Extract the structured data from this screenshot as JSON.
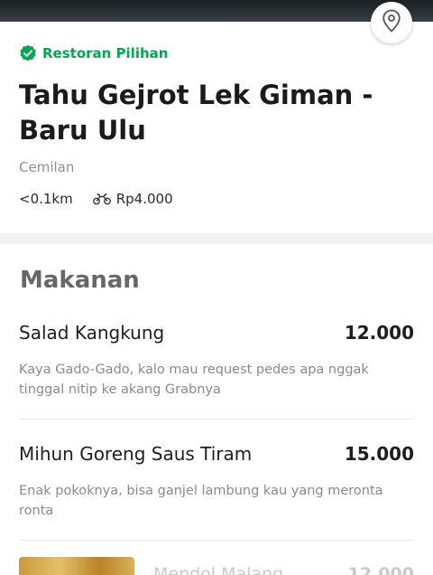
{
  "header": {
    "badge_label": "Restoran Pilihan",
    "icons": {
      "badge": "verified-check-icon",
      "map": "map-pin-icon",
      "delivery": "motorbike-icon"
    },
    "accent_color": "#00a651"
  },
  "restaurant": {
    "name": "Tahu Gejrot Lek Giman - Baru Ulu",
    "category": "Cemilan",
    "distance": "<0.1km",
    "delivery_fee": "Rp4.000"
  },
  "menu": {
    "section_title": "Makanan",
    "items": [
      {
        "name": "Salad Kangkung",
        "price": "12.000",
        "description": "Kaya Gado-Gado, kalo mau request pedes apa nggak tinggal nitip ke akang Grabnya"
      },
      {
        "name": "Mihun Goreng Saus Tiram",
        "price": "15.000",
        "description": "Enak pokoknya, bisa ganjel lambung kau yang meronta ronta"
      },
      {
        "name": "Mendol Malang",
        "price": "12.000"
      }
    ]
  }
}
